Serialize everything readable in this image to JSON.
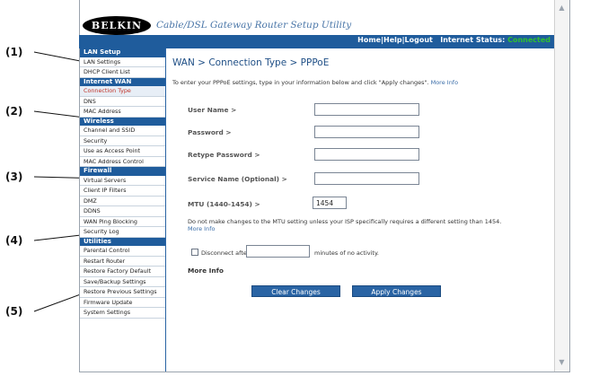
{
  "header": {
    "logo": "BELKIN",
    "app_title": "Cable/DSL Gateway Router Setup Utility",
    "links": [
      "Home",
      "Help",
      "Logout"
    ],
    "status_label": "Internet Status:",
    "status_value": "Connected"
  },
  "sidebar": [
    {
      "title": "LAN Setup",
      "items": [
        "LAN Settings",
        "DHCP Client List"
      ]
    },
    {
      "title": "Internet WAN",
      "items": [
        "Connection Type",
        "DNS",
        "MAC Address"
      ],
      "selected": 0
    },
    {
      "title": "Wireless",
      "items": [
        "Channel and SSID",
        "Security",
        "Use as Access Point",
        "MAC Address Control"
      ]
    },
    {
      "title": "Firewall",
      "items": [
        "Virtual Servers",
        "Client IP Filters",
        "DMZ",
        "DDNS",
        "WAN Ping Blocking",
        "Security Log"
      ]
    },
    {
      "title": "Utilities",
      "items": [
        "Parental Control",
        "Restart Router",
        "Restore Factory Default",
        "Save/Backup Settings",
        "Restore Previous Settings",
        "Firmware Update",
        "System Settings"
      ]
    }
  ],
  "page": {
    "title": "WAN > Connection Type > PPPoE",
    "intro": "To enter your PPPoE settings, type in your information below and click \"Apply changes\".",
    "more_info": "More Info",
    "fields": {
      "username_label": "User Name >",
      "password_label": "Password >",
      "retype_label": "Retype Password >",
      "service_label": "Service Name (Optional) >",
      "mtu_label": "MTU (1440-1454) >",
      "mtu_value": "1454"
    },
    "mtu_note": "Do not make changes to the MTU setting unless your ISP specifically requires a different setting than 1454.",
    "disconnect_prefix": "Disconnect after",
    "disconnect_suffix": "minutes of no activity.",
    "buttons": {
      "clear": "Clear Changes",
      "apply": "Apply Changes"
    }
  },
  "callouts": [
    "(1)",
    "(2)",
    "(3)",
    "(4)",
    "(5)"
  ]
}
